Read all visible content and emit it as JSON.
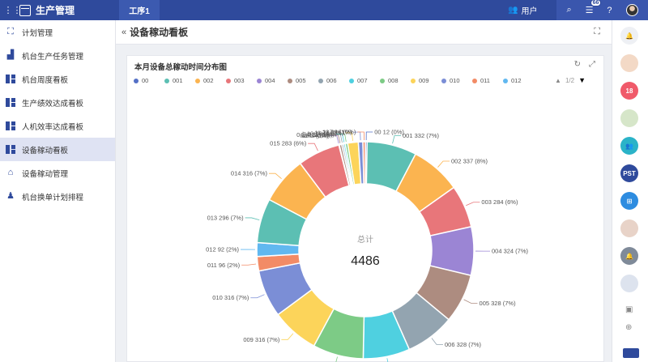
{
  "header": {
    "app_title": "生产管理",
    "tab": "工序1",
    "users_label": "用户",
    "badge": "66"
  },
  "sidebar": {
    "items": [
      {
        "label": "计划管理",
        "icon": "plan-icon"
      },
      {
        "label": "机台生产任务管理",
        "icon": "chart-icon"
      },
      {
        "label": "机台周度看板",
        "icon": "blocks-icon"
      },
      {
        "label": "生产绩效达成看板",
        "icon": "blocks-icon"
      },
      {
        "label": "人机效率达成看板",
        "icon": "blocks-icon"
      },
      {
        "label": "设备稼动看板",
        "icon": "blocks-icon",
        "active": true
      },
      {
        "label": "设备稼动管理",
        "icon": "home-icon"
      },
      {
        "label": "机台换单计划排程",
        "icon": "person-icon"
      }
    ]
  },
  "page": {
    "title": "设备稼动看板"
  },
  "chart_card": {
    "title": "本月设备总稼动时间分布图",
    "pager": "1/2",
    "center_label": "总计",
    "center_value": "4486"
  },
  "chart_data": {
    "type": "pie",
    "title": "本月设备总稼动时间分布图",
    "total": 4486,
    "legend": [
      "00",
      "001",
      "002",
      "003",
      "004",
      "005",
      "006",
      "007",
      "008",
      "009",
      "010",
      "011",
      "012"
    ],
    "slices": [
      {
        "name": "00",
        "value": 12,
        "label": "00  12 (0%)",
        "color": "#5470c6"
      },
      {
        "name": "001",
        "value": 332,
        "label": "001  332 (7%)",
        "color": "#5cbfb3"
      },
      {
        "name": "002",
        "value": 337,
        "label": "002  337 (8%)",
        "color": "#fbb450"
      },
      {
        "name": "003",
        "value": 284,
        "label": "003  284 (6%)",
        "color": "#e8767a"
      },
      {
        "name": "004",
        "value": 324,
        "label": "004  324 (7%)",
        "color": "#9b85d4"
      },
      {
        "name": "005",
        "value": 328,
        "label": "005  328 (7%)",
        "color": "#ad8c80"
      },
      {
        "name": "006",
        "value": 328,
        "label": "006  328 (7%)",
        "color": "#93a4b0"
      },
      {
        "name": "007",
        "value": 312,
        "label": "007  312 (7%)",
        "color": "#4fd0e0"
      },
      {
        "name": "008",
        "value": 338,
        "label": "008  338 (8%)",
        "color": "#7dcb86"
      },
      {
        "name": "009",
        "value": 316,
        "label": "009  316 (7%)",
        "color": "#fcd45a"
      },
      {
        "name": "010",
        "value": 316,
        "label": "010  316 (7%)",
        "color": "#7b8ed6"
      },
      {
        "name": "011",
        "value": 96,
        "label": "011  96 (2%)",
        "color": "#f28b66"
      },
      {
        "name": "012",
        "value": 92,
        "label": "012  92 (2%)",
        "color": "#61b8f0"
      },
      {
        "name": "013",
        "value": 296,
        "label": "013  296 (7%)",
        "color": "#5cbfb3"
      },
      {
        "name": "014",
        "value": 316,
        "label": "014  316 (7%)",
        "color": "#fbb450"
      },
      {
        "name": "015",
        "value": 283,
        "label": "015  283 (6%)",
        "color": "#e8767a"
      },
      {
        "name": "02",
        "value": 3,
        "label": "02  3 (0%)",
        "color": "#9b85d4"
      },
      {
        "name": "03",
        "value": 16,
        "label": "03  16 (0%)",
        "color": "#ad8c80"
      },
      {
        "name": "0点4",
        "value": 12,
        "label": "0点4  12 (0%)",
        "color": "#93a4b0"
      },
      {
        "name": "1",
        "value": 12,
        "label": "1  12 (0%)",
        "color": "#4fd0e0"
      },
      {
        "name": "10",
        "value": 16,
        "label": "10  16 (0%)",
        "color": "#7dcb86"
      },
      {
        "name": "11",
        "value": 71,
        "label": "11  71 (2%)",
        "color": "#fcd45a"
      },
      {
        "name": "12",
        "value": 30,
        "label": "12  30 (1%)",
        "color": "#7b8ed6"
      },
      {
        "name": "7",
        "value": 16,
        "label": "7  16 (0%)",
        "color": "#f28b66"
      }
    ],
    "legend_colors": [
      "#5470c6",
      "#5cbfb3",
      "#fbb450",
      "#e8767a",
      "#9b85d4",
      "#ad8c80",
      "#93a4b0",
      "#4fd0e0",
      "#7dcb86",
      "#fcd45a",
      "#7b8ed6",
      "#f28b66",
      "#61b8f0"
    ]
  },
  "rightbar": {
    "icons": [
      "bell-icon",
      "group-avatar",
      "calendar-icon",
      "person-avatar",
      "team-icon",
      "pst-icon",
      "org-icon",
      "woman-avatar",
      "notification-icon",
      "group-avatar-2",
      "contact-icon",
      "add-icon",
      "card-icon"
    ],
    "pst_label": "PST"
  }
}
